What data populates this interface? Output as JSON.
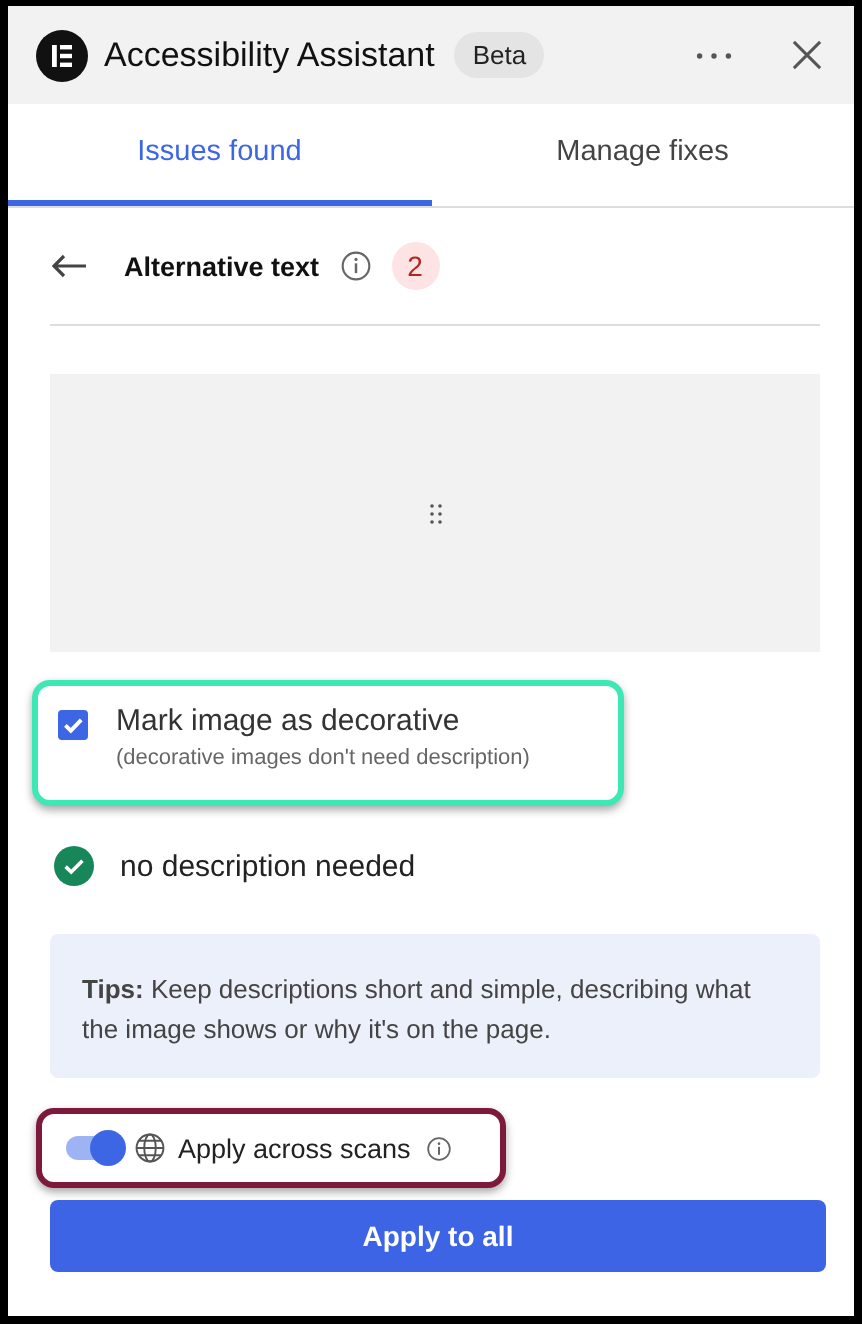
{
  "header": {
    "title": "Accessibility Assistant",
    "badge": "Beta"
  },
  "tabs": [
    {
      "label": "Issues found",
      "selected": true
    },
    {
      "label": "Manage fixes",
      "selected": false
    }
  ],
  "issue": {
    "title": "Alternative text",
    "count": "2"
  },
  "decorative": {
    "label": "Mark image as decorative",
    "hint": "(decorative images don't need description)",
    "checked": true
  },
  "status": {
    "text": "no description needed"
  },
  "tips": {
    "text": "**Tips:** Keep descriptions short and simple, describing what the image shows or why it's on the page."
  },
  "apply_across": {
    "label": "Apply across scans",
    "on": true
  },
  "button": "Apply to all"
}
